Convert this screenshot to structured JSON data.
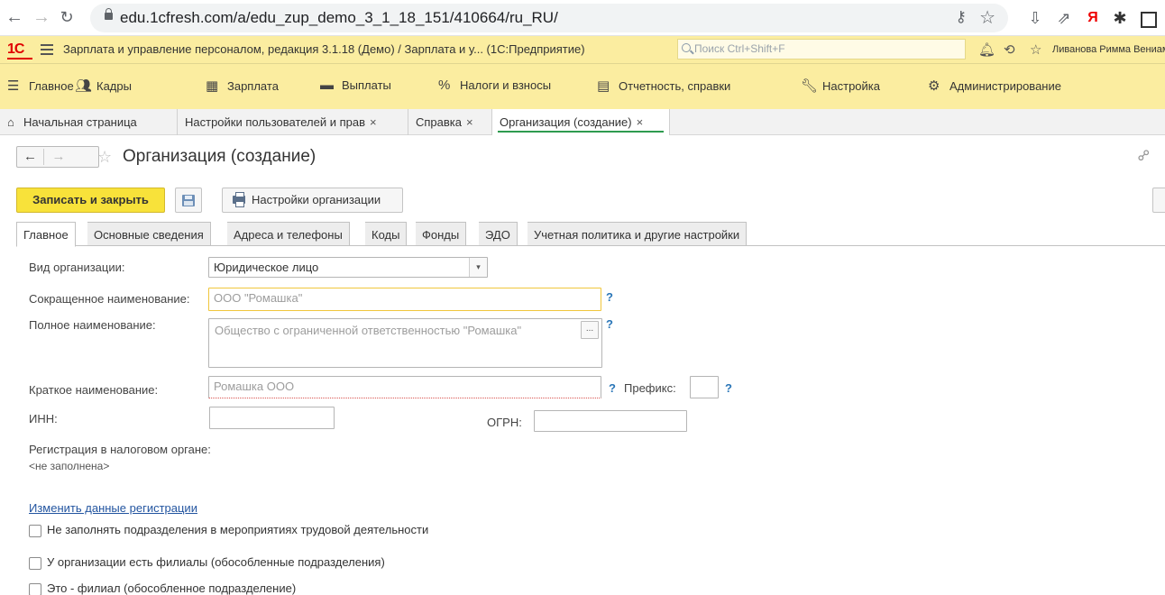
{
  "browser": {
    "url": "edu.1cfresh.com/a/edu_zup_demo_3_1_18_151/410664/ru_RU/"
  },
  "app": {
    "title": "Зарплата и управление персоналом, редакция 3.1.18 (Демо) / Зарплата и у...  (1С:Предприятие)",
    "search_placeholder": "Поиск Ctrl+Shift+F",
    "user": "Ливанова Римма Вениами"
  },
  "sections": [
    {
      "label": "Главное"
    },
    {
      "label": "Кадры"
    },
    {
      "label": "Зарплата"
    },
    {
      "label": "Выплаты"
    },
    {
      "label": "Налоги и взносы"
    },
    {
      "label": "Отчетность, справки"
    },
    {
      "label": "Настройка"
    },
    {
      "label": "Администрирование"
    }
  ],
  "open_tabs": {
    "home": "Начальная страница",
    "users": "Настройки пользователей и прав",
    "help": "Справка",
    "org": "Организация (создание)",
    "close": "×"
  },
  "form": {
    "title": "Организация (создание)",
    "buttons": {
      "save_close": "Записать и закрыть",
      "org_settings": "Настройки организации"
    },
    "tabs": [
      {
        "label": "Главное"
      },
      {
        "label": "Основные сведения"
      },
      {
        "label": "Адреса и телефоны"
      },
      {
        "label": "Коды"
      },
      {
        "label": "Фонды"
      },
      {
        "label": "ЭДО"
      },
      {
        "label": "Учетная политика и другие настройки"
      }
    ],
    "fields": {
      "org_type": {
        "label": "Вид организации:",
        "value": "Юридическое лицо"
      },
      "short_name": {
        "label": "Сокращенное наименование:",
        "placeholder": "ООО \"Ромашка\""
      },
      "full_name": {
        "label": "Полное наименование:",
        "placeholder": "Общество с ограниченной ответственностью \"Ромашка\"",
        "button": "..."
      },
      "brief_name": {
        "label": "Краткое наименование:",
        "placeholder": "Ромашка ООО"
      },
      "prefix": {
        "label": "Префикс:",
        "value": ""
      },
      "inn": {
        "label": "ИНН:",
        "value": ""
      },
      "ogrn": {
        "label": "ОГРН:",
        "value": ""
      },
      "tax_registration": {
        "label": "Регистрация в налоговом органе:",
        "value": "<не заполнена>"
      }
    },
    "help_mark": "?",
    "change_link": "Изменить данные регистрации",
    "checkboxes": [
      {
        "label": "Не заполнять подразделения в мероприятиях трудовой деятельности",
        "checked": false
      },
      {
        "label": "У организации есть филиалы (обособленные подразделения)",
        "checked": false
      },
      {
        "label": "Это - филиал (обособленное подразделение)",
        "checked": false
      }
    ]
  }
}
